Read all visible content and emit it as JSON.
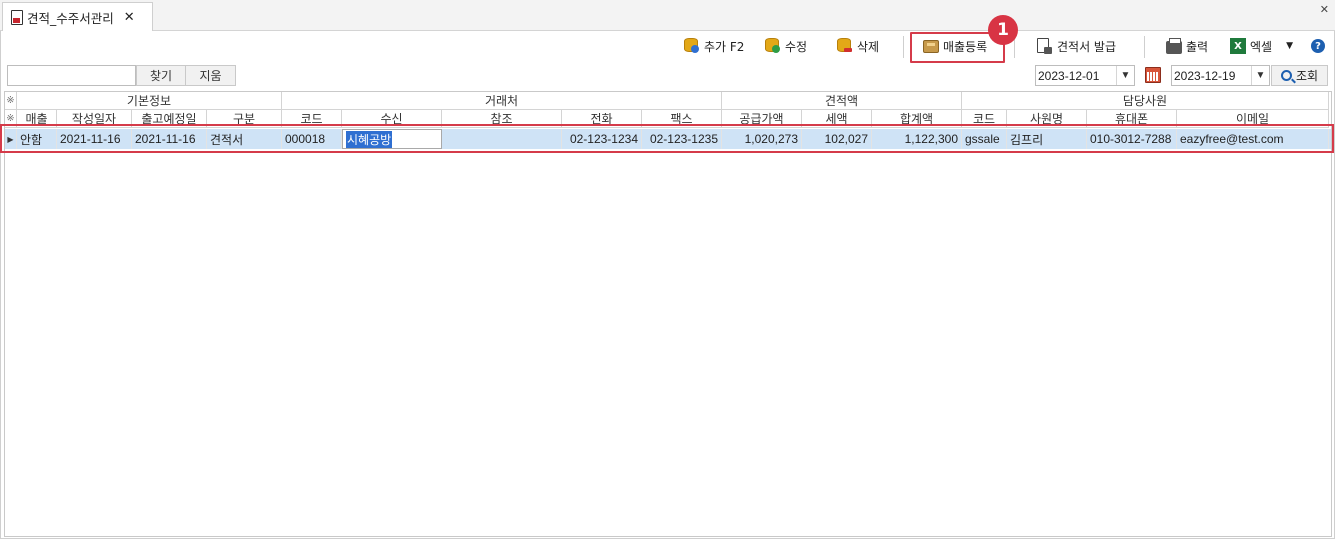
{
  "tab": {
    "title": "견적_수주서관리",
    "close": "✕",
    "window_close": "✕"
  },
  "toolbar": {
    "add_label": "추가 F2",
    "edit_label": "수정",
    "delete_label": "삭제",
    "register_sales_label": "매출등록",
    "issue_quote_label": "견적서 발급",
    "print_label": "출력",
    "excel_label": "엑셀",
    "excel_caret": "▼",
    "help_label": "?",
    "excel_icon_text": "X",
    "badge_number": "1",
    "highlight_color": "#d53b4a"
  },
  "search": {
    "input_value": "",
    "find_label": "찾기",
    "clear_label": "지움",
    "date_from": "2023-12-01",
    "date_to": "2023-12-19",
    "date_dropdown": "▼",
    "query_label": "조회"
  },
  "grid": {
    "corner_marker": "※",
    "groups": [
      "기본정보",
      "거래처",
      "견적액",
      "담당사원"
    ],
    "columns": [
      "매출",
      "작성일자",
      "출고예정일",
      "구분",
      "코드",
      "수신",
      "참조",
      "전화",
      "팩스",
      "공급가액",
      "세액",
      "합계액",
      "코드",
      "사원명",
      "휴대폰",
      "이메일"
    ],
    "rows": [
      {
        "indicator": "▶",
        "sales": "안함",
        "written_date": "2021-11-16",
        "ship_date": "2021-11-16",
        "type": "견적서",
        "client_code": "000018",
        "recipient": "시혜공방",
        "reference": "",
        "phone": "02-123-1234",
        "fax": "02-123-1235",
        "supply_amount": "1,020,273",
        "tax": "102,027",
        "total": "1,122,300",
        "staff_code": "gssale",
        "staff_name": "김프리",
        "mobile": "010-3012-7288",
        "email": "eazyfree@test.com"
      }
    ],
    "selected_row_color": "#cfe3f6"
  }
}
